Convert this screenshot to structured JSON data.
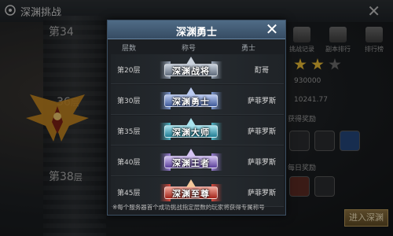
{
  "background": {
    "title": "深渊挑战",
    "floors": [
      {
        "num": "第34",
        "unit": ""
      },
      {
        "num": "36",
        "unit": "层"
      },
      {
        "num": "第38",
        "unit": "层"
      }
    ],
    "right_panel": {
      "buttons": [
        "挑战记录",
        "副本排行",
        "排行榜"
      ],
      "value_1": "930000",
      "value_2": "10241.77",
      "label_1": "获得奖励",
      "label_2": "每日奖励"
    },
    "enter_button": "进入深渊"
  },
  "modal": {
    "title": "深渊勇士",
    "columns": {
      "floor": "层数",
      "title": "称号",
      "warrior": "勇士"
    },
    "rows": [
      {
        "floor": "第20层",
        "badge": "深渊战将",
        "warrior": "酊哥",
        "color": "#9aa6b8"
      },
      {
        "floor": "第30层",
        "badge": "深渊勇士",
        "warrior": "萨菲罗斯",
        "color": "#7f9bd6"
      },
      {
        "floor": "第35层",
        "badge": "深渊大师",
        "warrior": "萨菲罗斯",
        "color": "#4fb6c8"
      },
      {
        "floor": "第40层",
        "badge": "深渊王者",
        "warrior": "萨菲罗斯",
        "color": "#9a7fd6"
      },
      {
        "floor": "第45层",
        "badge": "深渊至尊",
        "warrior": "萨菲罗斯",
        "color": "#d6483c"
      }
    ],
    "note": "※每个服务器首个成功挑战指定层数的玩家将获得专属称号"
  }
}
